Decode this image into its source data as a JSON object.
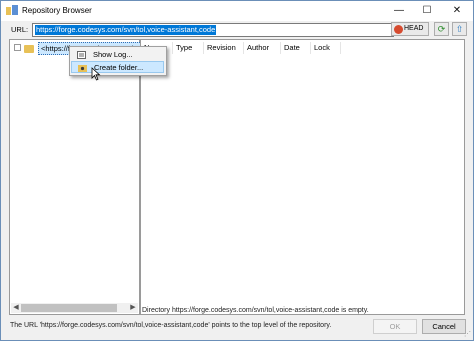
{
  "window": {
    "title": "Repository Browser",
    "controls": {
      "minimize": "—",
      "maximize": "☐",
      "close": "✕"
    }
  },
  "toolbar": {
    "url_label": "URL:",
    "url_value": "https://forge.codesys.com/svn/tol,voice-assistant,code",
    "head_label": "HEAD",
    "refresh_icon": "refresh-icon",
    "up_icon": "up-arrow-icon"
  },
  "tree": {
    "root_label": "<https://forge.codesys.com/svn/tol,voice-assistant,code>"
  },
  "list": {
    "columns": [
      "Na",
      "Type",
      "Revision",
      "Author",
      "Date",
      "Lock"
    ]
  },
  "context_menu": {
    "items": [
      {
        "label": "Show Log...",
        "icon": "log-icon"
      },
      {
        "label": "Create folder...",
        "icon": "new-folder-icon"
      }
    ]
  },
  "status": {
    "directory_status": "Directory https://forge.codesys.com/svn/tol,voice-assistant,code is empty.",
    "info": "The URL 'https://forge.codesys.com/svn/tol,voice-assistant,code' points to the top level of the repository."
  },
  "buttons": {
    "ok": "OK",
    "cancel": "Cancel"
  },
  "colors": {
    "selection": "#0078d7",
    "tree_selection": "#cce8ff",
    "folder": "#e8c157"
  }
}
